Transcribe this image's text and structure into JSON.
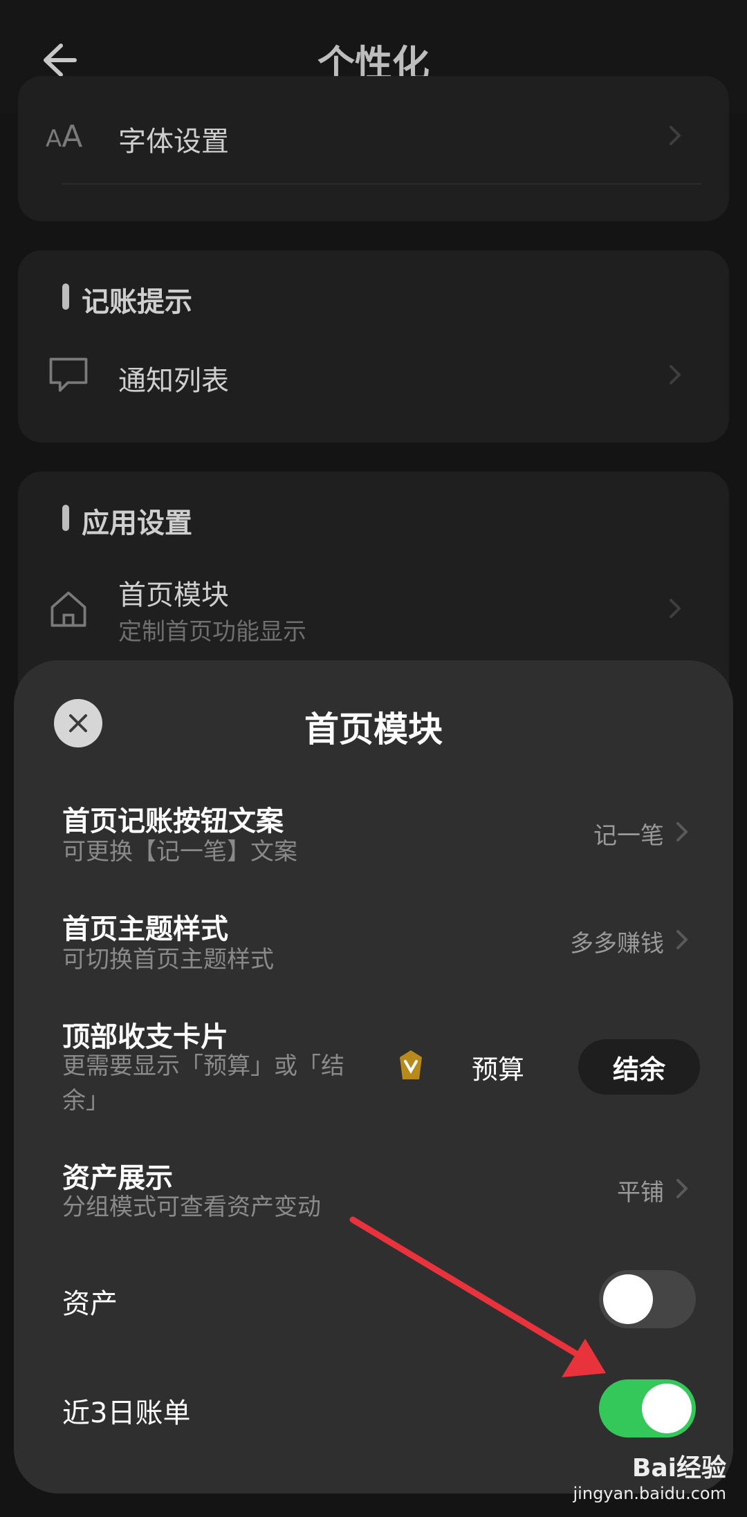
{
  "header": {
    "title": "个性化"
  },
  "settings": {
    "font_row": {
      "label": "字体设置"
    },
    "section_reminder": {
      "title": "记账提示"
    },
    "notification_row": {
      "label": "通知列表"
    },
    "section_app": {
      "title": "应用设置"
    },
    "home_module_row": {
      "label": "首页模块",
      "sub": "定制首页功能显示"
    }
  },
  "sheet": {
    "title": "首页模块",
    "items": [
      {
        "title": "首页记账按钮文案",
        "sub": "可更换【记一笔】文案",
        "value": "记一笔"
      },
      {
        "title": "首页主题样式",
        "sub": "可切换首页主题样式",
        "value": "多多赚钱"
      },
      {
        "title": "顶部收支卡片",
        "sub": "更需要显示「预算」或「结\n余」",
        "segments": [
          "预算",
          "结余"
        ],
        "selected": "结余"
      },
      {
        "title": "资产展示",
        "sub": "分组模式可查看资产变动",
        "value": "平铺"
      },
      {
        "title": "资产",
        "toggle_on": false
      },
      {
        "title": "近3日账单",
        "toggle_on": true
      }
    ]
  },
  "colors": {
    "accent_green": "#34c759",
    "annotation_red": "#e8333c"
  },
  "watermark": {
    "brand": "Bai经验",
    "url": "jingyan.baidu.com"
  }
}
